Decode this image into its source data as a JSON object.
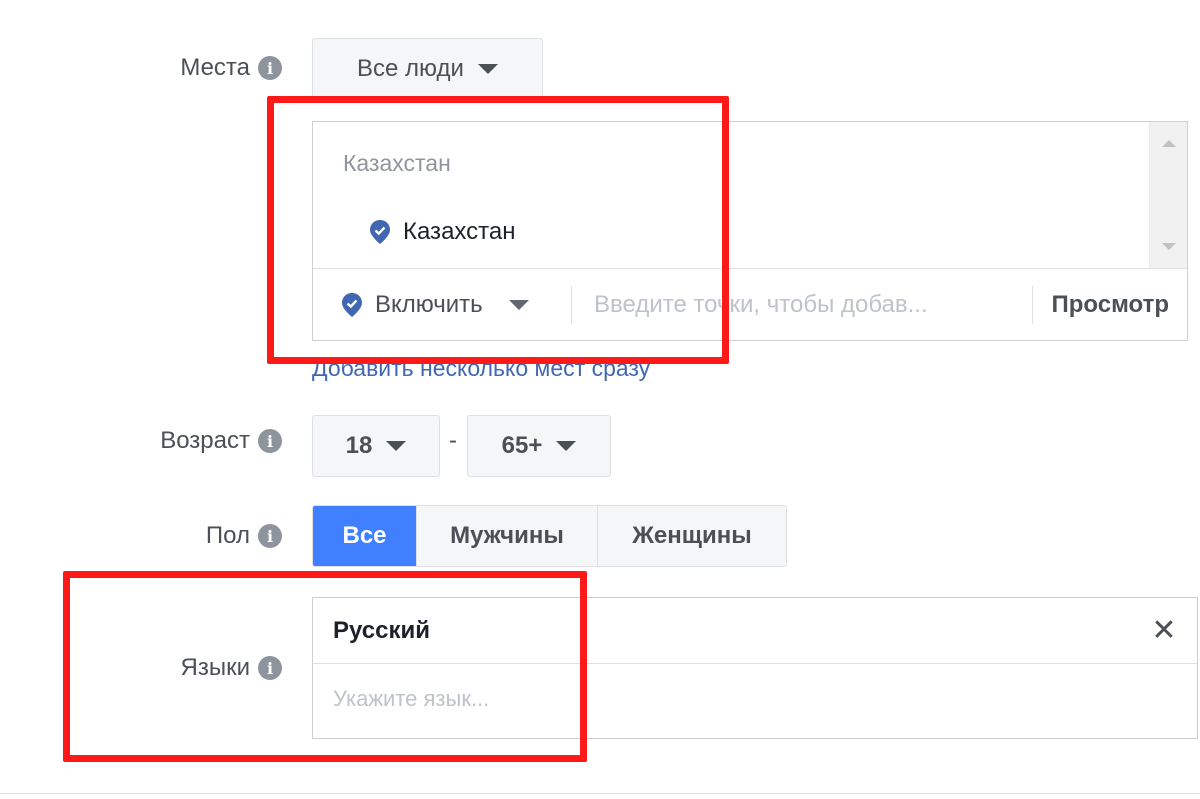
{
  "locations": {
    "label": "Места",
    "audience_dropdown": "Все люди",
    "country_header": "Казахстан",
    "selected_item": "Казахстан",
    "include_dropdown": "Включить",
    "input_placeholder": "Введите точки, чтобы добав...",
    "browse_label": "Просмотр",
    "add_many_link": "Добавить несколько мест сразу"
  },
  "age": {
    "label": "Возраст",
    "min": "18",
    "separator": "-",
    "max": "65+"
  },
  "gender": {
    "label": "Пол",
    "options": [
      "Все",
      "Мужчины",
      "Женщины"
    ],
    "selected": "Все"
  },
  "languages": {
    "label": "Языки",
    "selected_token": "Русский",
    "remove_symbol": "✕",
    "input_placeholder": "Укажите язык..."
  },
  "colors": {
    "accent": "#4080ff",
    "link": "#4267b2",
    "annotation": "#ff1a1a",
    "pin": "#4267b2"
  },
  "icons": [
    "info-icon",
    "caret-down-icon",
    "location-pin-icon",
    "close-icon"
  ]
}
